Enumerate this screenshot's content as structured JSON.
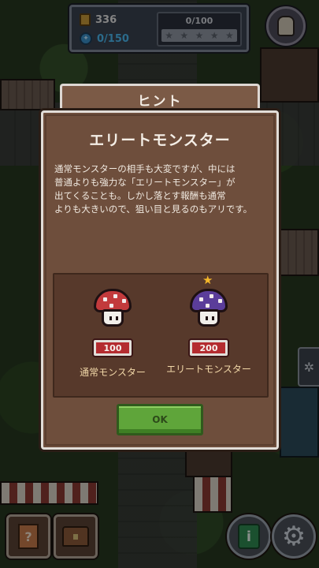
{
  "hud": {
    "gold": "336",
    "mana": "0/150",
    "progress": "0/100",
    "stars_filled": 0,
    "stars_total": 5,
    "gold_icon": "gold-scroll-icon",
    "mana_icon": "mana-orb-icon"
  },
  "dialog": {
    "tab_title": "ヒント",
    "heading": "エリートモンスター",
    "body": "通常モンスターの相手も大変ですが、中には\n普通よりも強力な「エリートモンスター」が\n出てくることも。しかし落とす報酬も通常\nよりも大きいので、狙い目と見るのもアリです。",
    "monsters": [
      {
        "label": "通常モンスター",
        "value": "100",
        "cap_color": "#c23a3c",
        "elite": false
      },
      {
        "label": "エリートモンスター",
        "value": "200",
        "cap_color": "#5b3d9a",
        "elite": true
      }
    ],
    "ok_label": "OK"
  },
  "bottom_bar": {
    "quest_icon": "question-scroll-icon",
    "chest_icon": "treasure-chest-icon",
    "info_icon": "info-icon",
    "settings_icon": "gear-icon"
  },
  "colors": {
    "panel": "#6e4e3c",
    "panel_border": "#e2ddd8",
    "price_badge": "#b42c30",
    "ok_button": "#5fa53a",
    "mana_text": "#4ab8f0"
  }
}
